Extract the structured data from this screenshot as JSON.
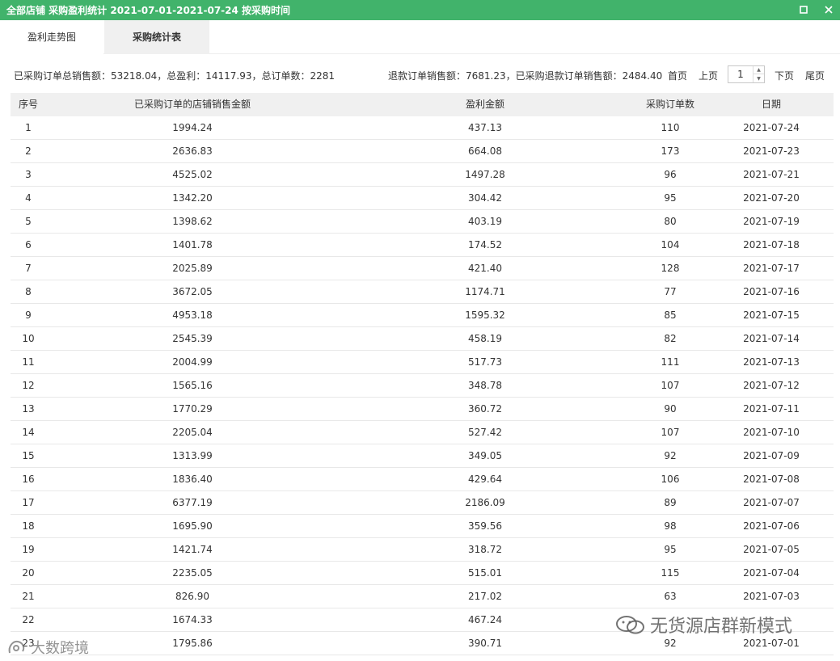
{
  "window": {
    "title": "全部店铺 采购盈利统计 2021-07-01-2021-07-24 按采购时间",
    "maximize_icon": "maximize-icon",
    "close_icon": "close-icon",
    "accent_color": "#41b36b"
  },
  "tabs": [
    {
      "label": "盈利走势图",
      "active": false
    },
    {
      "label": "采购统计表",
      "active": true
    }
  ],
  "summary": {
    "left": "已采购订单总销售额：53218.04，总盈利：14117.93，总订单数：2281",
    "right": "退款订单销售额：7681.23，已采购退款订单销售额：2484.40"
  },
  "pager": {
    "first": "首页",
    "prev": "上页",
    "page": "1",
    "next": "下页",
    "last": "尾页"
  },
  "table": {
    "headers": [
      "序号",
      "已采购订单的店铺销售金额",
      "盈利金额",
      "采购订单数",
      "日期"
    ],
    "rows": [
      [
        "1",
        "1994.24",
        "437.13",
        "110",
        "2021-07-24"
      ],
      [
        "2",
        "2636.83",
        "664.08",
        "173",
        "2021-07-23"
      ],
      [
        "3",
        "4525.02",
        "1497.28",
        "96",
        "2021-07-21"
      ],
      [
        "4",
        "1342.20",
        "304.42",
        "95",
        "2021-07-20"
      ],
      [
        "5",
        "1398.62",
        "403.19",
        "80",
        "2021-07-19"
      ],
      [
        "6",
        "1401.78",
        "174.52",
        "104",
        "2021-07-18"
      ],
      [
        "7",
        "2025.89",
        "421.40",
        "128",
        "2021-07-17"
      ],
      [
        "8",
        "3672.05",
        "1174.71",
        "77",
        "2021-07-16"
      ],
      [
        "9",
        "4953.18",
        "1595.32",
        "85",
        "2021-07-15"
      ],
      [
        "10",
        "2545.39",
        "458.19",
        "82",
        "2021-07-14"
      ],
      [
        "11",
        "2004.99",
        "517.73",
        "111",
        "2021-07-13"
      ],
      [
        "12",
        "1565.16",
        "348.78",
        "107",
        "2021-07-12"
      ],
      [
        "13",
        "1770.29",
        "360.72",
        "90",
        "2021-07-11"
      ],
      [
        "14",
        "2205.04",
        "527.42",
        "107",
        "2021-07-10"
      ],
      [
        "15",
        "1313.99",
        "349.05",
        "92",
        "2021-07-09"
      ],
      [
        "16",
        "1836.40",
        "429.64",
        "106",
        "2021-07-08"
      ],
      [
        "17",
        "6377.19",
        "2186.09",
        "89",
        "2021-07-07"
      ],
      [
        "18",
        "1695.90",
        "359.56",
        "98",
        "2021-07-06"
      ],
      [
        "19",
        "1421.74",
        "318.72",
        "95",
        "2021-07-05"
      ],
      [
        "20",
        "2235.05",
        "515.01",
        "115",
        "2021-07-04"
      ],
      [
        "21",
        "826.90",
        "217.02",
        "63",
        "2021-07-03"
      ],
      [
        "22",
        "1674.33",
        "467.24",
        "",
        ""
      ],
      [
        "23",
        "1795.86",
        "390.71",
        "92",
        "2021-07-01"
      ]
    ]
  },
  "watermarks": {
    "right": "无货源店群新模式",
    "right_icon": "wechat-icon",
    "left": "大数跨境",
    "left_icon": "brand-logo-icon"
  }
}
